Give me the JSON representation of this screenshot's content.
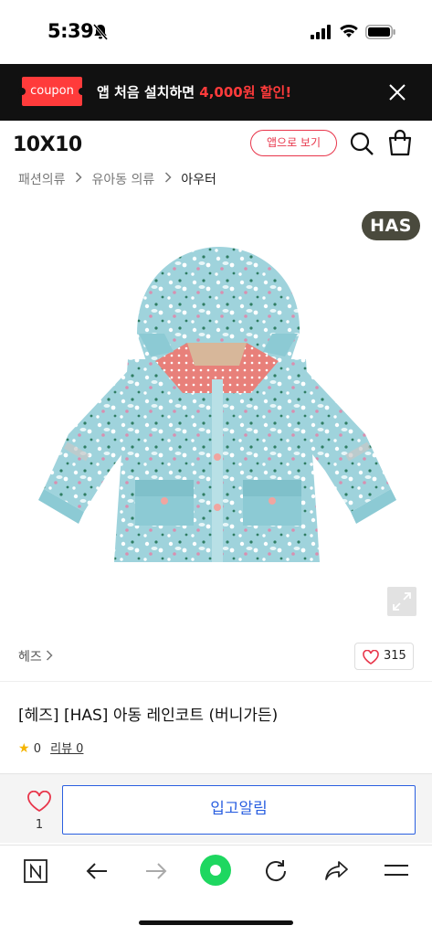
{
  "status_bar": {
    "time": "5:39"
  },
  "banner": {
    "coupon_label": "coupon",
    "text_main": "앱 처음 설치하면 ",
    "text_highlight": "4,000원 할인!"
  },
  "header": {
    "logo": "10X10",
    "app_button": "앱으로 보기"
  },
  "breadcrumb": [
    "패션의류",
    "유아동 의류",
    "아우터"
  ],
  "product": {
    "brand_badge": "HAS",
    "brand_name": "헤즈",
    "like_count": "315",
    "title": "[헤즈] [HAS] 아동 레인코트 (버니가든)",
    "rating": "0",
    "review_label": "리뷰 0"
  },
  "action_bar": {
    "wish_count": "1",
    "notify_label": "입고알림"
  },
  "colors": {
    "accent_red": "#e8364b",
    "coupon_red": "#ff3b3b",
    "action_blue": "#2a5fe0",
    "refresh_green": "#1ed760"
  },
  "icons": [
    "bell-off-icon",
    "signal-icon",
    "wifi-icon",
    "battery-icon",
    "close-icon",
    "search-icon",
    "shopping-bag-icon",
    "chevron-right-icon",
    "expand-icon",
    "heart-icon",
    "star-icon",
    "naver-n-icon",
    "back-arrow-icon",
    "forward-arrow-icon",
    "green-dot-icon",
    "refresh-icon",
    "share-icon",
    "menu-icon"
  ]
}
